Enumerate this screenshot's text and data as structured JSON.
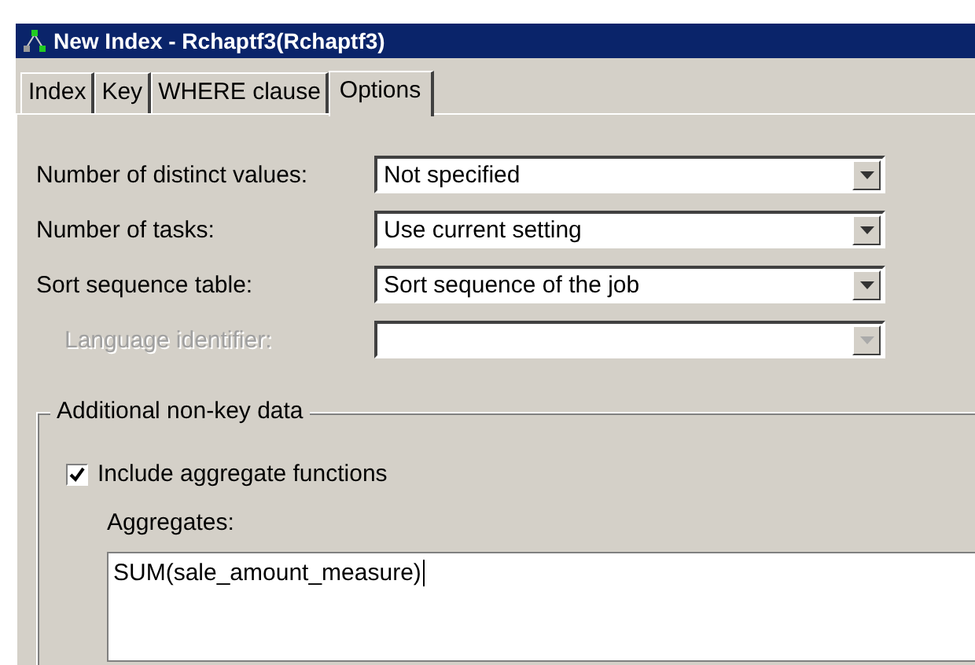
{
  "window": {
    "title": "New Index - Rchaptf3(Rchaptf3)"
  },
  "tabs": [
    {
      "label": "Index",
      "selected": false
    },
    {
      "label": "Key",
      "selected": false
    },
    {
      "label": "WHERE clause",
      "selected": false
    },
    {
      "label": "Options",
      "selected": true
    }
  ],
  "fields": [
    {
      "label": "Number of distinct values:",
      "value": "Not specified",
      "disabled": false
    },
    {
      "label": "Number of tasks:",
      "value": "Use current setting",
      "disabled": false
    },
    {
      "label": "Sort sequence table:",
      "value": "Sort sequence of the job",
      "disabled": false
    },
    {
      "label": "Language identifier:",
      "disabled": true
    }
  ],
  "group": {
    "title": "Additional non-key data",
    "checkbox": {
      "label": "Include aggregate functions",
      "checked": true
    },
    "aggregates_label": "Aggregates:",
    "aggregates_value": "SUM(sale_amount_measure)"
  }
}
